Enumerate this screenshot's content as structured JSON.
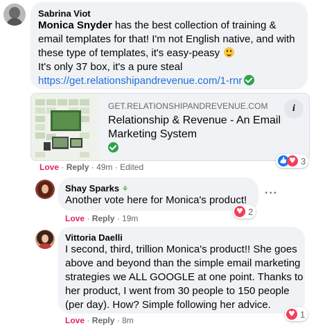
{
  "comment1": {
    "author": "Sabrina Viot",
    "mention": "Monica Snyder",
    "line1_rest": " has the best collection of training &",
    "line2": "email templates for that! I'm not English native, and with",
    "line3": "these type of templates, it's easy-peasy",
    "line4": "It's only 37 box, it's a pure steal",
    "link": "https://get.relationshipandrevenue.com/1-rnr",
    "preview": {
      "domain": "GET.RELATIONSHIPANDREVENUE.COM",
      "title_line1": "Relationship & Revenue - An Email",
      "title_line2": "Marketing System"
    },
    "actions": {
      "love": "Love",
      "reply": "Reply",
      "time": "49m",
      "edited": "Edited"
    },
    "reaction_count": "3",
    "info_icon": "i"
  },
  "reply1": {
    "author": "Shay Sparks",
    "text": "Another vote here for Monica's product!",
    "actions": {
      "love": "Love",
      "reply": "Reply",
      "time": "19m"
    },
    "reaction_count": "2",
    "more": "···"
  },
  "reply2": {
    "author": "Vittoria Daelli",
    "lines": [
      "I second, third, trillion Monica's product!! She goes",
      "above and beyond than the simple email marketing",
      "strategies we ALL GOOGLE at one point. Thanks to",
      "her product, I went from 30 people to 150 people",
      "(per day). How? Simple following her advice."
    ],
    "actions": {
      "love": "Love",
      "reply": "Reply",
      "time": "8m"
    },
    "reaction_count": "1"
  },
  "colors": {
    "accent": "#216fdb",
    "love": "#e0245e",
    "bubble": "#f0f2f5",
    "verified": "#31a24c"
  },
  "separator": "·"
}
